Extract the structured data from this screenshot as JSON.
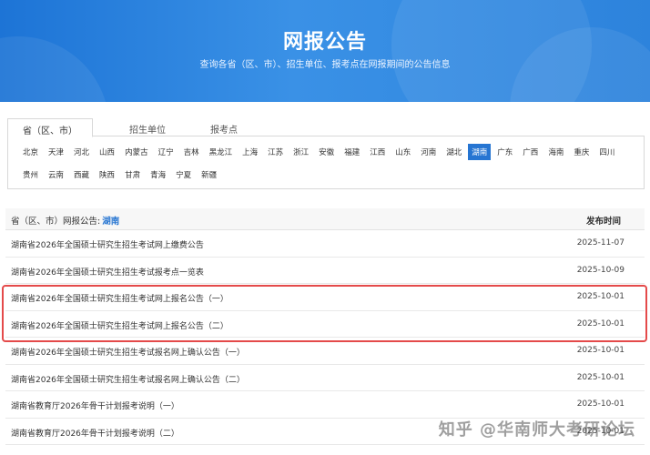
{
  "banner": {
    "title": "网报公告",
    "subtitle": "查询各省（区、市）、招生单位、报考点在网报期间的公告信息"
  },
  "tabs": [
    {
      "label": "省（区、市）",
      "active": true
    },
    {
      "label": "招生单位",
      "active": false
    },
    {
      "label": "报考点",
      "active": false
    }
  ],
  "provinces": {
    "row1": [
      "北京",
      "天津",
      "河北",
      "山西",
      "内蒙古",
      "辽宁",
      "吉林",
      "黑龙江",
      "上海",
      "江苏",
      "浙江",
      "安徽",
      "福建",
      "江西",
      "山东",
      "河南",
      "湖北",
      "湖南",
      "广东",
      "广西",
      "海南",
      "重庆",
      "四川"
    ],
    "row2": [
      "贵州",
      "云南",
      "西藏",
      "陕西",
      "甘肃",
      "青海",
      "宁夏",
      "新疆"
    ],
    "selected": "湖南"
  },
  "list": {
    "header_label": "省（区、市）网报公告:",
    "header_region": "湖南",
    "date_header": "发布时间",
    "rows": [
      {
        "title": "湖南省2026年全国硕士研究生招生考试网上缴费公告",
        "date": "2025-11-07"
      },
      {
        "title": "湖南省2026年全国硕士研究生招生考试报考点一览表",
        "date": "2025-10-09"
      },
      {
        "title": "湖南省2026年全国硕士研究生招生考试网上报名公告（一）",
        "date": "2025-10-01"
      },
      {
        "title": "湖南省2026年全国硕士研究生招生考试网上报名公告（二）",
        "date": "2025-10-01"
      },
      {
        "title": "湖南省2026年全国硕士研究生招生考试报名网上确认公告（一）",
        "date": "2025-10-01"
      },
      {
        "title": "湖南省2026年全国硕士研究生招生考试报名网上确认公告（二）",
        "date": "2025-10-01"
      },
      {
        "title": "湖南省教育厅2026年骨干计划报考说明（一）",
        "date": "2025-10-01"
      },
      {
        "title": "湖南省教育厅2026年骨干计划报考说明（二）",
        "date": "2025-10-01"
      }
    ]
  },
  "watermark": "知乎 @华南师大考研论坛",
  "colors": {
    "banner": "#2d83dc",
    "selected": "#2675d2",
    "highlight": "#e44a4a"
  }
}
